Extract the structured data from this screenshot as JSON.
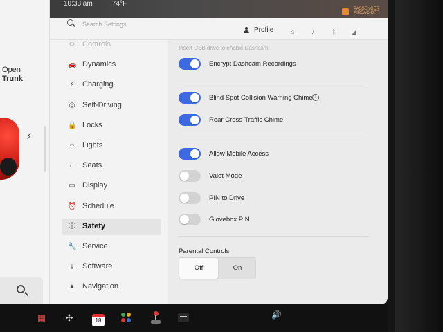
{
  "status": {
    "time": "10:33 am",
    "temperature": "74°F",
    "airbag_line1": "PASSENGER",
    "airbag_line2": "AIRBAG OFF"
  },
  "car": {
    "trunk_action": "Open",
    "trunk_label": "Trunk"
  },
  "header": {
    "search_placeholder": "Search Settings",
    "profile_label": "Profile",
    "icons": [
      "home-icon",
      "bell-icon",
      "bluetooth-icon",
      "signal-icon"
    ]
  },
  "sidebar": {
    "items": [
      {
        "label": "Controls",
        "icon": "toggle-icon",
        "glyph": "⚙",
        "active": false,
        "faded": true
      },
      {
        "label": "Dynamics",
        "icon": "car-icon",
        "glyph": "🚗",
        "active": false
      },
      {
        "label": "Charging",
        "icon": "bolt-icon",
        "glyph": "⚡",
        "active": false
      },
      {
        "label": "Self-Driving",
        "icon": "steering-wheel-icon",
        "glyph": "◎",
        "active": false
      },
      {
        "label": "Locks",
        "icon": "lock-icon",
        "glyph": "🔒",
        "active": false
      },
      {
        "label": "Lights",
        "icon": "sun-icon",
        "glyph": "☼",
        "active": false
      },
      {
        "label": "Seats",
        "icon": "seat-icon",
        "glyph": "⌐",
        "active": false
      },
      {
        "label": "Display",
        "icon": "display-icon",
        "glyph": "▭",
        "active": false
      },
      {
        "label": "Schedule",
        "icon": "alarm-clock-icon",
        "glyph": "⏰",
        "active": false
      },
      {
        "label": "Safety",
        "icon": "alert-circle-icon",
        "glyph": "ⓘ",
        "active": true
      },
      {
        "label": "Service",
        "icon": "wrench-icon",
        "glyph": "🔧",
        "active": false
      },
      {
        "label": "Software",
        "icon": "download-icon",
        "glyph": "⤓",
        "active": false
      },
      {
        "label": "Navigation",
        "icon": "navigation-icon",
        "glyph": "▲",
        "active": false
      }
    ]
  },
  "content": {
    "hint": "Insert USB drive to enable Dashcam",
    "toggles": [
      {
        "label": "Encrypt Dashcam Recordings",
        "on": true
      },
      {
        "label": "Blind Spot Collision Warning Chime",
        "on": true,
        "info": true
      },
      {
        "label": "Rear Cross-Traffic Chime",
        "on": true
      },
      {
        "label": "Allow Mobile Access",
        "on": true
      },
      {
        "label": "Valet Mode",
        "on": false
      },
      {
        "label": "PIN to Drive",
        "on": false
      },
      {
        "label": "Glovebox PIN",
        "on": false
      }
    ],
    "parental": {
      "title": "Parental Controls",
      "off_label": "Off",
      "on_label": "On",
      "selected": "Off"
    }
  },
  "taskbar": {
    "calendar_day": "18"
  },
  "colors": {
    "toggle_on": "#3e6ae1",
    "toggle_off": "#d3d3d3",
    "accent_red": "#e0322d"
  }
}
